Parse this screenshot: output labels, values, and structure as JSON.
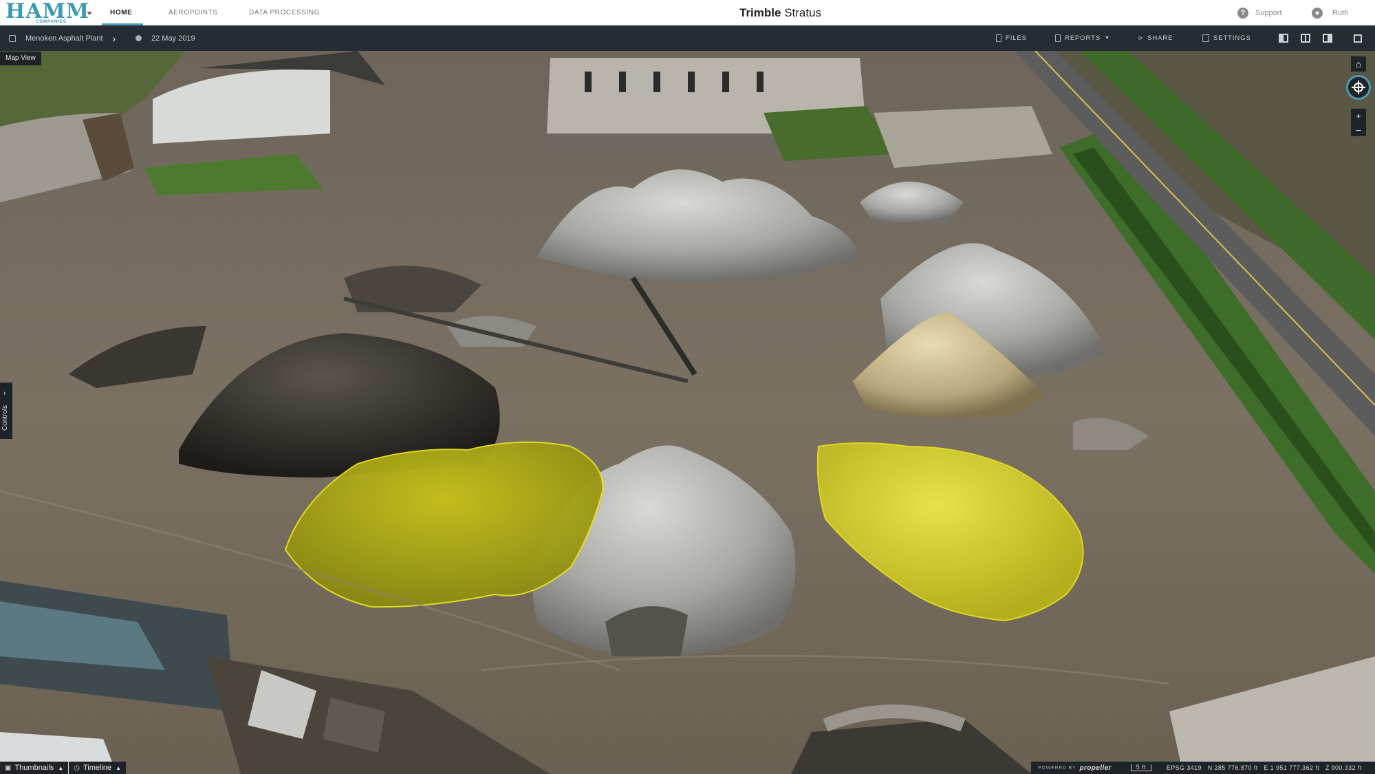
{
  "header": {
    "logo_text": "HAMM",
    "logo_sub": "COMPANIES",
    "tabs": [
      {
        "label": "HOME",
        "active": true
      },
      {
        "label": "AEROPOINTS",
        "active": false
      },
      {
        "label": "DATA PROCESSING",
        "active": false
      }
    ],
    "brand_bold": "Trimble",
    "brand_light": "Stratus",
    "support_label": "Support",
    "user_name": "Ruth"
  },
  "toolbar": {
    "site_name": "Menoken Asphalt Plant",
    "date": "22 May 2019",
    "files_label": "FILES",
    "reports_label": "REPORTS",
    "share_label": "SHARE",
    "settings_label": "SETTINGS"
  },
  "map": {
    "view_label": "Map View",
    "controls_label": "Controls",
    "highlight_color": "#e6e01f",
    "accent_color": "#4a9bb5"
  },
  "bottom": {
    "thumbnails_label": "Thumbnails",
    "timeline_label": "Timeline",
    "powered_by": "POWERED BY",
    "propeller": "propeller",
    "scale_label": "5 ft",
    "epsg": "EPSG 3419",
    "north": "N 285 776.870 ft",
    "east": "E 1 951 777.362 ft",
    "z": "Z 900.332 ft"
  }
}
